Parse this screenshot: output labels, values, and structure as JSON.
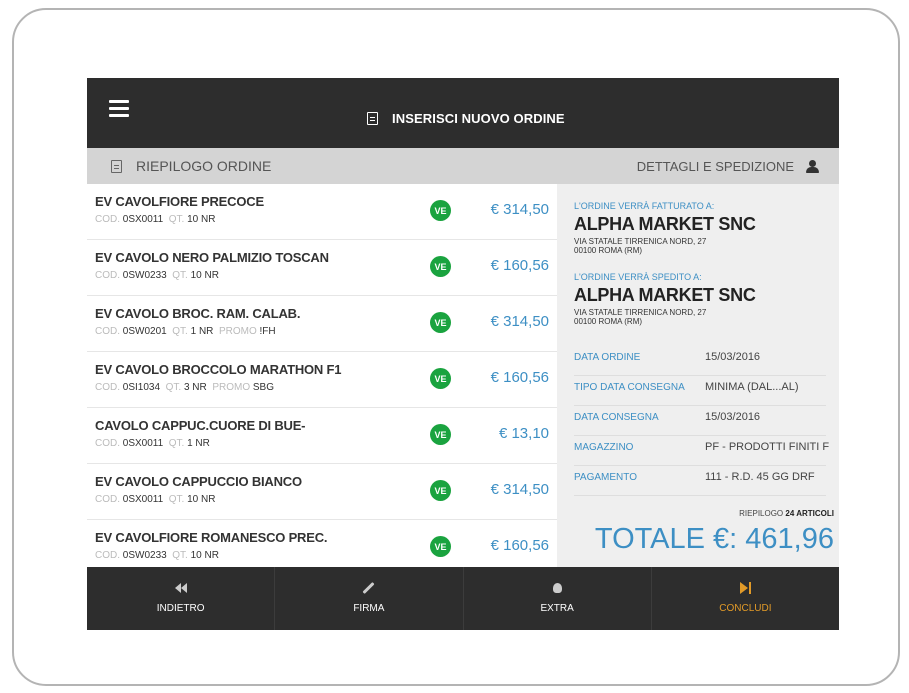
{
  "header": {
    "title": "INSERISCI NUOVO ORDINE"
  },
  "subheader": {
    "left": "RIEPILOGO ORDINE",
    "right": "DETTAGLI E SPEDIZIONE"
  },
  "labels": {
    "cod": "COD.",
    "qt": "QT.",
    "promo": "PROMO"
  },
  "items": [
    {
      "name": "EV CAVOLFIORE PRECOCE",
      "code": "0SX0011",
      "qty": "10 NR",
      "promo": "",
      "badge": "VE",
      "price": "€ 314,50"
    },
    {
      "name": "EV CAVOLO NERO PALMIZIO TOSCAN",
      "code": "0SW0233",
      "qty": "10 NR",
      "promo": "",
      "badge": "VE",
      "price": "€ 160,56"
    },
    {
      "name": "EV CAVOLO BROC. RAM. CALAB.",
      "code": "0SW0201",
      "qty": "1 NR",
      "promo": "!FH",
      "badge": "VE",
      "price": "€ 314,50"
    },
    {
      "name": "EV CAVOLO BROCCOLO MARATHON F1",
      "code": "0SI1034",
      "qty": "3 NR",
      "promo": "SBG",
      "badge": "VE",
      "price": "€ 160,56"
    },
    {
      "name": "CAVOLO CAPPUC.CUORE DI BUE-",
      "code": "0SX0011",
      "qty": "1 NR",
      "promo": "",
      "badge": "VE",
      "price": "€ 13,10"
    },
    {
      "name": "EV CAVOLO CAPPUCCIO BIANCO",
      "code": "0SX0011",
      "qty": "10 NR",
      "promo": "",
      "badge": "VE",
      "price": "€ 314,50"
    },
    {
      "name": "EV CAVOLFIORE ROMANESCO PREC.",
      "code": "0SW0233",
      "qty": "10 NR",
      "promo": "",
      "badge": "VE",
      "price": "€ 160,56"
    }
  ],
  "billing": {
    "caption": "L'ORDINE VERRÀ FATTURATO A:",
    "company": "ALPHA MARKET SNC",
    "address1": "VIA STATALE TIRRENICA NORD, 27",
    "address2": "00100 ROMA (RM)"
  },
  "shipping": {
    "caption": "L'ORDINE VERRÀ SPEDITO A:",
    "company": "ALPHA MARKET SNC",
    "address1": "VIA STATALE TIRRENICA NORD, 27",
    "address2": "00100 ROMA (RM)"
  },
  "details": [
    {
      "key": "DATA ORDINE",
      "value": "15/03/2016"
    },
    {
      "key": "TIPO DATA CONSEGNA",
      "value": "MINIMA (DAL...AL)"
    },
    {
      "key": "DATA CONSEGNA",
      "value": "15/03/2016"
    },
    {
      "key": "MAGAZZINO",
      "value": "PF - PRODOTTI FINITI F"
    },
    {
      "key": "PAGAMENTO",
      "value": "111 - R.D. 45 GG DRF"
    }
  ],
  "summary": {
    "label": "RIEPILOGO",
    "count": "24 ARTICOLI"
  },
  "total": "TOTALE €: 461,96",
  "footer": [
    {
      "label": "INDIETRO",
      "icon": "rewind-icon"
    },
    {
      "label": "FIRMA",
      "icon": "pencil-icon"
    },
    {
      "label": "EXTRA",
      "icon": "bulb-icon"
    },
    {
      "label": "CONCLUDI",
      "icon": "skip-forward-icon"
    }
  ],
  "colors": {
    "accent": "#3d8fc4",
    "badge": "#1aa33f",
    "confirm": "#e19a28",
    "bar": "#2d2d2d"
  }
}
